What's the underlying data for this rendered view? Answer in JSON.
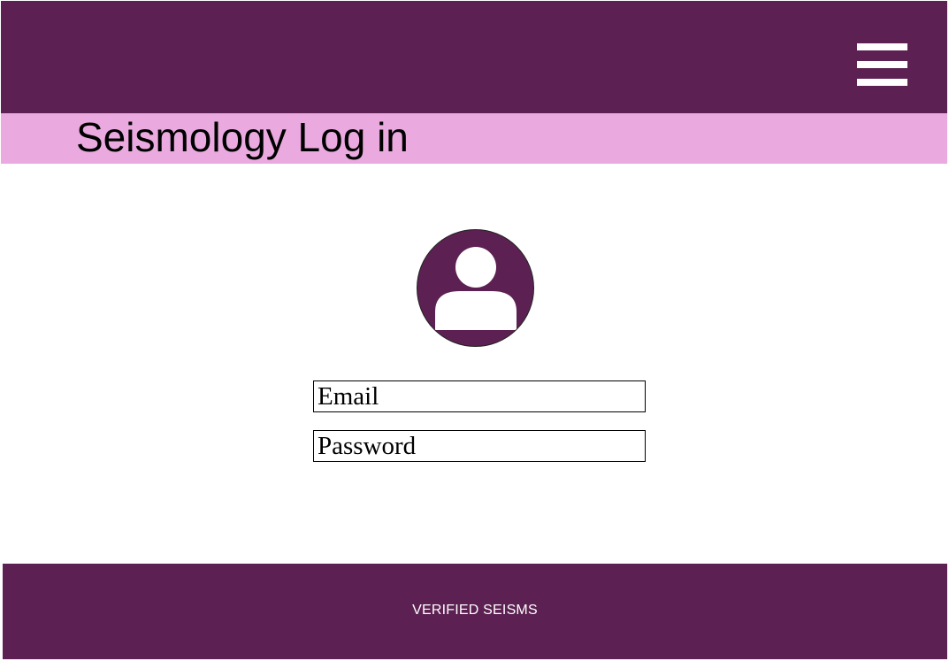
{
  "header": {
    "menu_icon": "hamburger-menu-icon",
    "background_color": "#5c2152"
  },
  "title_band": {
    "title": "Seismology Log in",
    "background_color": "#eaaadf"
  },
  "login": {
    "avatar_icon": "user-avatar-icon",
    "email_placeholder": "Email",
    "email_value": "",
    "password_placeholder": "Password",
    "password_value": ""
  },
  "footer": {
    "text": "VERIFIED SEISMS"
  }
}
